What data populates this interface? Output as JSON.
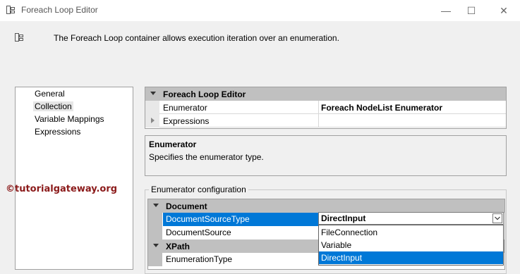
{
  "window": {
    "title": "Foreach Loop Editor",
    "minimize": "—",
    "maximize": "☐",
    "close": "✕"
  },
  "header": {
    "description": "The Foreach Loop container allows execution iteration over an enumeration."
  },
  "nav": {
    "items": [
      {
        "label": "General",
        "selected": false
      },
      {
        "label": "Collection",
        "selected": true
      },
      {
        "label": "Variable Mappings",
        "selected": false
      },
      {
        "label": "Expressions",
        "selected": false
      }
    ]
  },
  "watermark": "©tutorialgateway.org",
  "properties": {
    "category": "Foreach Loop Editor",
    "rows": [
      {
        "name": "Enumerator",
        "value": "Foreach NodeList Enumerator"
      },
      {
        "name": "Expressions",
        "value": ""
      }
    ]
  },
  "description": {
    "title": "Enumerator",
    "text": "Specifies the enumerator type."
  },
  "enumerator_config": {
    "label": "Enumerator configuration",
    "categories": [
      {
        "label": "Document"
      },
      {
        "label": "XPath"
      }
    ],
    "rows": [
      {
        "name": "DocumentSourceType",
        "value": "DirectInput"
      },
      {
        "name": "DocumentSource",
        "value": ""
      },
      {
        "name": "EnumerationType",
        "value": ""
      }
    ],
    "dropdown_options": [
      "FileConnection",
      "Variable",
      "DirectInput"
    ],
    "dropdown_selected": "DirectInput"
  },
  "colors": {
    "selection": "#0078d7",
    "category_bg": "#c0c0c0",
    "watermark": "#8b1a1a"
  }
}
